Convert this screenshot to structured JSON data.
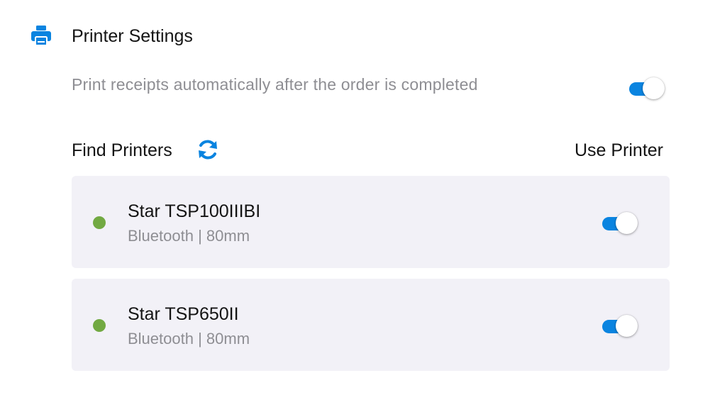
{
  "header": {
    "title": "Printer Settings",
    "icon": "printer-icon"
  },
  "auto_print": {
    "label": "Print receipts automatically after the order is completed",
    "enabled": true
  },
  "find_printers": {
    "label": "Find Printers",
    "refresh_icon": "refresh-icon",
    "use_printer_label": "Use Printer"
  },
  "printers": [
    {
      "name": "Star TSP100IIIBI",
      "meta": "Bluetooth | 80mm",
      "status": "connected",
      "enabled": true
    },
    {
      "name": "Star TSP650II",
      "meta": "Bluetooth | 80mm",
      "status": "connected",
      "enabled": true
    }
  ],
  "colors": {
    "accent": "#0a84e0",
    "status_green": "#72a942",
    "card_bg": "#f2f1f7",
    "muted_text": "#8e8e93"
  }
}
